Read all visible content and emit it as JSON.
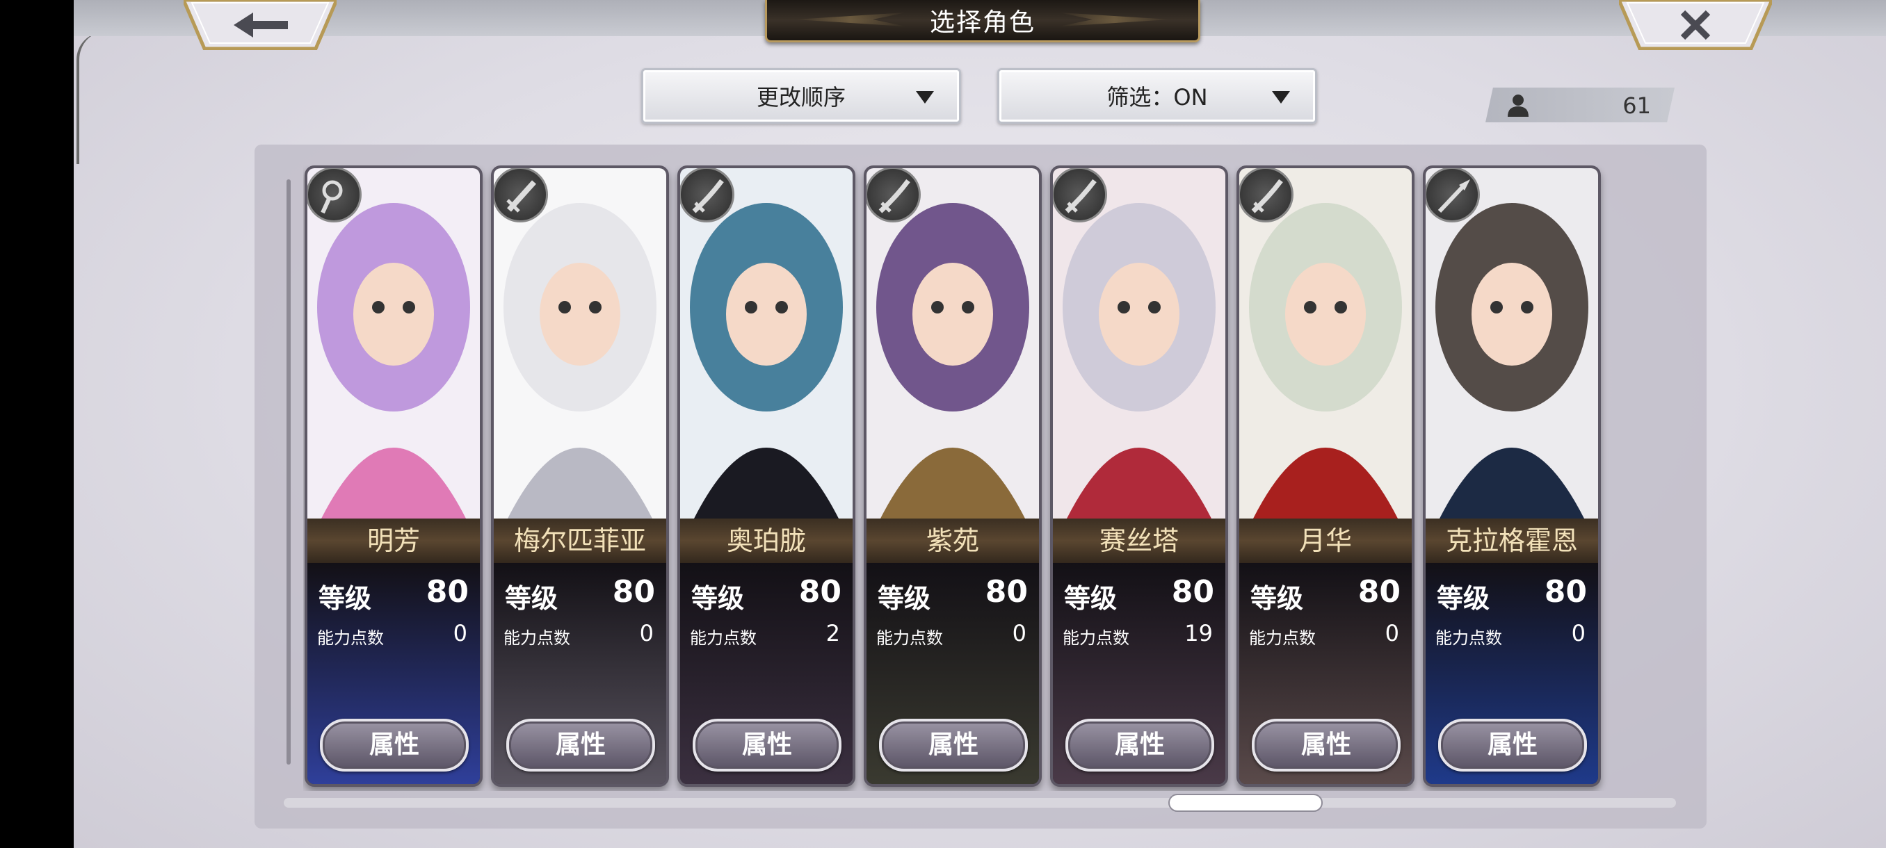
{
  "header": {
    "title": "选择角色",
    "back_icon": "arrow-left",
    "close_icon": "x-close"
  },
  "sort_dropdown": {
    "label": "更改顺序"
  },
  "filter_dropdown": {
    "label": "筛选：ON"
  },
  "character_count": "61",
  "stat_labels": {
    "level": "等级",
    "ability_points": "能力点数",
    "attributes_button": "属性"
  },
  "characters": [
    {
      "name": "明芳",
      "level": "80",
      "ability_points": "0",
      "weapon": "staff",
      "stats_bg": "#2f3f9a"
    },
    {
      "name": "梅尔匹菲亚",
      "level": "80",
      "ability_points": "0",
      "weapon": "sword",
      "stats_bg": "#5a5560"
    },
    {
      "name": "奥珀胧",
      "level": "80",
      "ability_points": "2",
      "weapon": "katana",
      "stats_bg": "#3b3040"
    },
    {
      "name": "紫苑",
      "level": "80",
      "ability_points": "0",
      "weapon": "katana",
      "stats_bg": "#3a3a30"
    },
    {
      "name": "赛丝塔",
      "level": "80",
      "ability_points": "19",
      "weapon": "katana",
      "stats_bg": "#4a3a48"
    },
    {
      "name": "月华",
      "level": "80",
      "ability_points": "0",
      "weapon": "katana",
      "stats_bg": "#5a4a4a"
    },
    {
      "name": "克拉格霍恩",
      "level": "80",
      "ability_points": "0",
      "weapon": "spear",
      "stats_bg": "#1f3a8a"
    }
  ]
}
